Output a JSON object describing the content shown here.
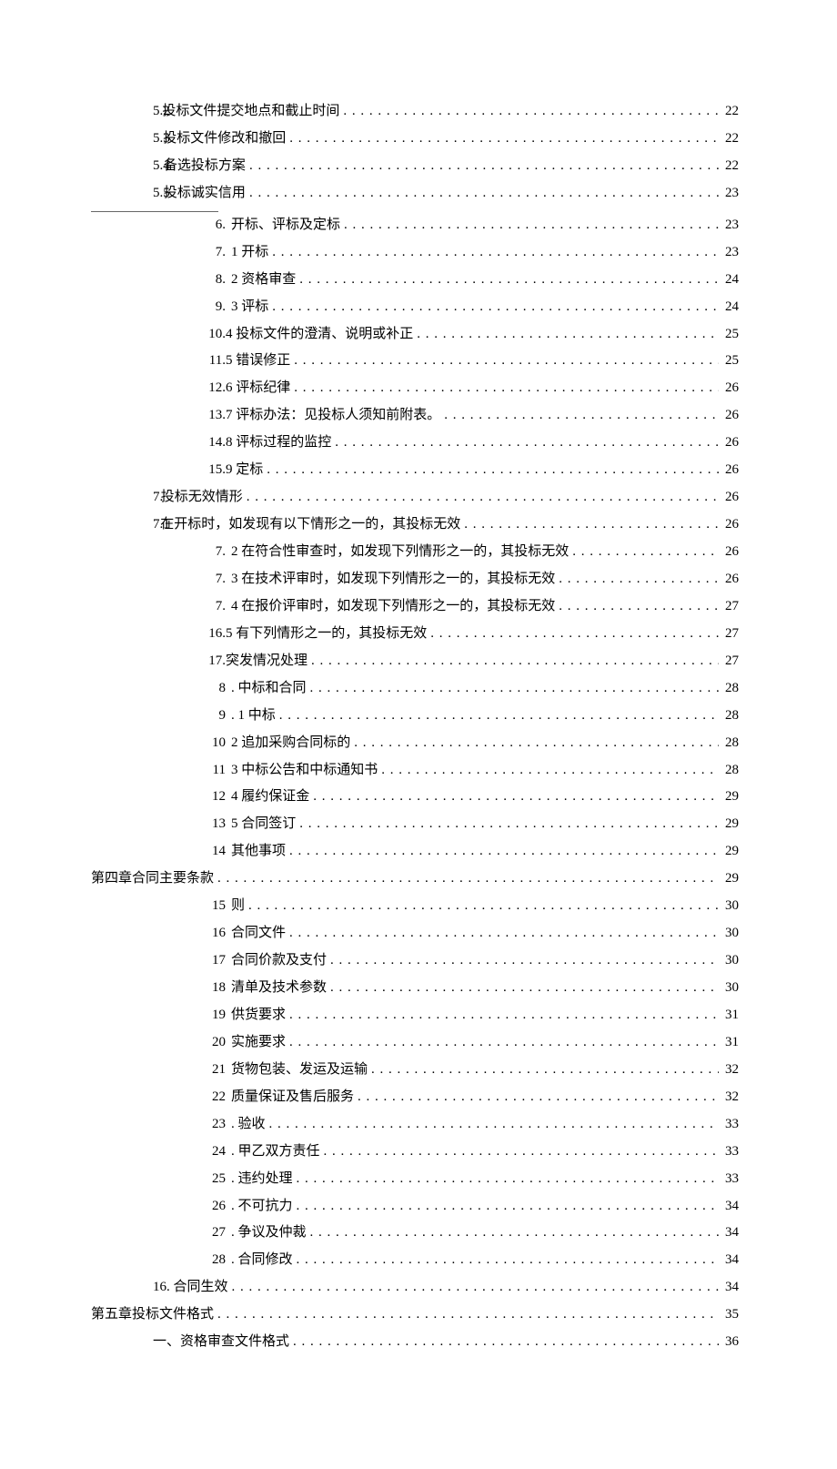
{
  "toc": [
    {
      "indent": 1,
      "num": "5.2",
      "title": "投标文件提交地点和截止时间",
      "page": "22",
      "noPrefixSpace": true
    },
    {
      "indent": 1,
      "num": "5.3",
      "title": "投标文件修改和撤回",
      "page": "22",
      "noPrefixSpace": true
    },
    {
      "indent": 1,
      "num": "5.4",
      "title": "备选投标方案",
      "page": "22",
      "noPrefixSpace": true
    },
    {
      "indent": 1,
      "num": "5.5",
      "title": "投标诚实信用",
      "page": "23",
      "noPrefixSpace": true,
      "hrAfter": true
    },
    {
      "indent": 2,
      "num": "6.",
      "title": "开标、评标及定标",
      "page": "23"
    },
    {
      "indent": 2,
      "num": "7.",
      "title": "1 开标",
      "page": "23"
    },
    {
      "indent": 2,
      "num": "8.",
      "title": "2 资格审查",
      "page": "24"
    },
    {
      "indent": 2,
      "num": "9.",
      "title": "3 评标",
      "page": "24"
    },
    {
      "indent": 2,
      "num": "10.",
      "title": "4 投标文件的澄清、说明或补正",
      "page": "25",
      "noGap": true
    },
    {
      "indent": 2,
      "num": "11.",
      "title": "5 错误修正",
      "page": "25",
      "noGap": true
    },
    {
      "indent": 2,
      "num": "12.",
      "title": "6 评标纪律",
      "page": "26",
      "noGap": true
    },
    {
      "indent": 2,
      "num": "13.",
      "title": "7 评标办法：见投标人须知前附表。",
      "page": "26",
      "noGap": true
    },
    {
      "indent": 2,
      "num": "14.",
      "title": "8 评标过程的监控",
      "page": "26",
      "noGap": true
    },
    {
      "indent": 2,
      "num": "15.",
      "title": "9 定标",
      "page": "26",
      "noGap": true
    },
    {
      "indent": 1,
      "num": "7.",
      "title": "投标无效情形",
      "page": "26",
      "noPrefixSpace": true
    },
    {
      "indent": 1,
      "num": "7.1",
      "title": " 在开标时，如发现有以下情形之一的，其投标无效",
      "page": "26",
      "noPrefixSpace": true
    },
    {
      "indent": 2,
      "num": "7.",
      "title": "2 在符合性审查时，如发现下列情形之一的，其投标无效",
      "page": "26"
    },
    {
      "indent": 2,
      "num": "7.",
      "title": "3 在技术评审时，如发现下列情形之一的，其投标无效",
      "page": "26"
    },
    {
      "indent": 2,
      "num": "7.",
      "title": "4 在报价评审时，如发现下列情形之一的，其投标无效",
      "page": "27"
    },
    {
      "indent": 2,
      "num": "16.",
      "title": "5 有下列情形之一的，其投标无效",
      "page": "27",
      "noGap": true
    },
    {
      "indent": 2,
      "num": "17.",
      "title": " 突发情况处理",
      "page": "27",
      "noGap": true
    },
    {
      "indent": 2,
      "num": "8",
      "title": ". 中标和合同",
      "page": "28"
    },
    {
      "indent": 2,
      "num": "9",
      "title": ". 1 中标",
      "page": "28"
    },
    {
      "indent": 2,
      "num": "10",
      "title": "2 追加采购合同标的",
      "page": "28"
    },
    {
      "indent": 2,
      "num": "11",
      "title": "3 中标公告和中标通知书",
      "page": "28"
    },
    {
      "indent": 2,
      "num": "12",
      "title": "4 履约保证金",
      "page": "29"
    },
    {
      "indent": 2,
      "num": "13",
      "title": "5 合同签订",
      "page": "29"
    },
    {
      "indent": 2,
      "num": "14",
      "title": "其他事项",
      "page": "29"
    },
    {
      "indent": 0,
      "num": "",
      "title": "第四章合同主要条款",
      "page": "29"
    },
    {
      "indent": 2,
      "num": "15",
      "title": " 则",
      "page": "30"
    },
    {
      "indent": 2,
      "num": "16",
      "title": "合同文件",
      "page": "30"
    },
    {
      "indent": 2,
      "num": "17",
      "title": "合同价款及支付",
      "page": "30"
    },
    {
      "indent": 2,
      "num": "18",
      "title": "清单及技术参数",
      "page": "30"
    },
    {
      "indent": 2,
      "num": "19",
      "title": "供货要求",
      "page": "31"
    },
    {
      "indent": 2,
      "num": "20",
      "title": "实施要求",
      "page": "31"
    },
    {
      "indent": 2,
      "num": "21",
      "title": "货物包装、发运及运输",
      "page": "32"
    },
    {
      "indent": 2,
      "num": "22",
      "title": "质量保证及售后服务",
      "page": "32"
    },
    {
      "indent": 2,
      "num": "23",
      "title": ". 验收",
      "page": "33"
    },
    {
      "indent": 2,
      "num": "24",
      "title": ". 甲乙双方责任",
      "page": "33"
    },
    {
      "indent": 2,
      "num": "25",
      "title": ". 违约处理",
      "page": "33"
    },
    {
      "indent": 2,
      "num": "26",
      "title": ". 不可抗力",
      "page": "34"
    },
    {
      "indent": 2,
      "num": "27",
      "title": ". 争议及仲裁",
      "page": "34"
    },
    {
      "indent": 2,
      "num": "28",
      "title": ". 合同修改",
      "page": "34"
    },
    {
      "indent": 1,
      "num": "",
      "title": "16. 合同生效",
      "page": "34"
    },
    {
      "indent": 0,
      "num": "",
      "title": "第五章投标文件格式",
      "page": "35"
    },
    {
      "indent": 1,
      "num": "",
      "title": "一、资格审查文件格式",
      "page": "36"
    }
  ]
}
